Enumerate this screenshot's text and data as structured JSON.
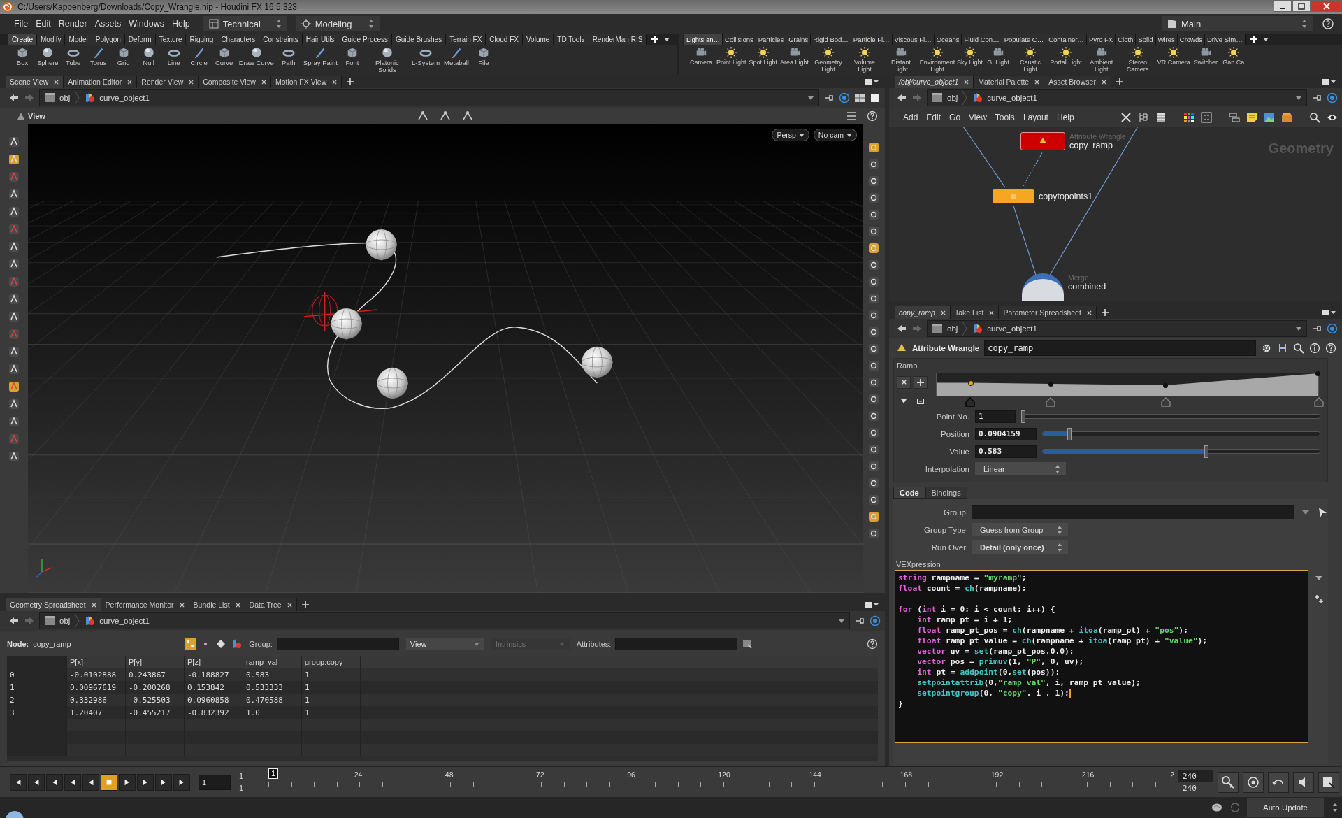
{
  "window": {
    "title": "C:/Users/Kappenberg/Downloads/Copy_Wrangle.hip - Houdini FX 16.5.323"
  },
  "menu": [
    "File",
    "Edit",
    "Render",
    "Assets",
    "Windows",
    "Help"
  ],
  "desktop": "Technical",
  "mode": "Modeling",
  "desktop_right": "Main",
  "shelf_left": {
    "tabs": [
      {
        "label": "Create",
        "selected": true
      },
      {
        "label": "Modify",
        "selected": false
      },
      {
        "label": "Model",
        "selected": false
      },
      {
        "label": "Polygon",
        "selected": false
      },
      {
        "label": "Deform",
        "selected": false
      },
      {
        "label": "Texture",
        "selected": false
      },
      {
        "label": "Rigging",
        "selected": false
      },
      {
        "label": "Characters",
        "selected": false
      },
      {
        "label": "Constraints",
        "selected": false
      },
      {
        "label": "Hair Utils",
        "selected": false
      },
      {
        "label": "Guide Process",
        "selected": false
      },
      {
        "label": "Guide Brushes",
        "selected": false
      },
      {
        "label": "Terrain FX",
        "selected": false
      },
      {
        "label": "Cloud FX",
        "selected": false
      },
      {
        "label": "Volume",
        "selected": false
      },
      {
        "label": "TD Tools",
        "selected": false
      },
      {
        "label": "RenderMan RIS",
        "selected": false
      }
    ],
    "tools": [
      "Box",
      "Sphere",
      "Tube",
      "Torus",
      "Grid",
      "Null",
      "Line",
      "Circle",
      "Curve",
      "Draw Curve",
      "Path",
      "Spray Paint",
      "Font",
      "Platonic Solids",
      "L-System",
      "Metaball",
      "File"
    ]
  },
  "shelf_right": {
    "tabs": [
      {
        "label": "Lights an…",
        "selected": true
      },
      {
        "label": "Collisions",
        "selected": false
      },
      {
        "label": "Particles",
        "selected": false
      },
      {
        "label": "Grains",
        "selected": false
      },
      {
        "label": "Rigid Bod…",
        "selected": false
      },
      {
        "label": "Particle Fl…",
        "selected": false
      },
      {
        "label": "Viscous Fl…",
        "selected": false
      },
      {
        "label": "Oceans",
        "selected": false
      },
      {
        "label": "Fluid Con…",
        "selected": false
      },
      {
        "label": "Populate C…",
        "selected": false
      },
      {
        "label": "Container…",
        "selected": false
      },
      {
        "label": "Pyro FX",
        "selected": false
      },
      {
        "label": "Cloth",
        "selected": false
      },
      {
        "label": "Solid",
        "selected": false
      },
      {
        "label": "Wires",
        "selected": false
      },
      {
        "label": "Crowds",
        "selected": false
      },
      {
        "label": "Drive Sim…",
        "selected": false
      }
    ],
    "tools": [
      "Camera",
      "Point Light",
      "Spot Light",
      "Area Light",
      "Geometry Light",
      "Volume Light",
      "Distant Light",
      "Environment Light",
      "Sky Light",
      "GI Light",
      "Caustic Light",
      "Portal Light",
      "Ambient Light",
      "Stereo Camera",
      "VR Camera",
      "Switcher",
      "Gan Ca"
    ]
  },
  "scene_view": {
    "tabs": [
      {
        "label": "Scene View",
        "selected": true
      },
      {
        "label": "Animation Editor",
        "selected": false
      },
      {
        "label": "Render View",
        "selected": false
      },
      {
        "label": "Composite View",
        "selected": false
      },
      {
        "label": "Motion FX View",
        "selected": false
      }
    ],
    "path": [
      "obj",
      "curve_object1"
    ],
    "view_label": "View",
    "camera_buttons": [
      "Persp",
      "No cam"
    ]
  },
  "spreadsheet": {
    "tabs": [
      {
        "label": "Geometry Spreadsheet",
        "selected": true
      },
      {
        "label": "Performance Monitor",
        "selected": false
      },
      {
        "label": "Bundle List",
        "selected": false
      },
      {
        "label": "Data Tree",
        "selected": false
      }
    ],
    "path": [
      "obj",
      "curve_object1"
    ],
    "node_label": "Node:",
    "node": "copy_ramp",
    "group_label": "Group:",
    "view": "View",
    "intrinsics": "Intrinsics",
    "attributes_label": "Attributes:",
    "columns": [
      "P[x]",
      "P[y]",
      "P[z]",
      "ramp_val",
      "group:copy"
    ],
    "rows": [
      {
        "index": "0",
        "cells": [
          "-0.0102888",
          "0.243867",
          "-0.188827",
          "0.583",
          "1"
        ]
      },
      {
        "index": "1",
        "cells": [
          "0.00967619",
          "-0.200268",
          "0.153842",
          "0.533333",
          "1"
        ]
      },
      {
        "index": "2",
        "cells": [
          "0.332986",
          "-0.525503",
          "0.0960858",
          "0.470588",
          "1"
        ]
      },
      {
        "index": "3",
        "cells": [
          "1.20407",
          "-0.455217",
          "-0.832392",
          "1.0",
          "1"
        ]
      }
    ]
  },
  "network": {
    "tabs": [
      {
        "label": "/obj/curve_object1",
        "selected": true
      },
      {
        "label": "Material Palette",
        "selected": false
      },
      {
        "label": "Asset Browser",
        "selected": false
      }
    ],
    "path": [
      "obj",
      "curve_object1"
    ],
    "menu": [
      "Add",
      "Edit",
      "Go",
      "View",
      "Tools",
      "Layout",
      "Help"
    ],
    "context": "Geometry",
    "nodes": [
      {
        "kind": "wrangle",
        "type": "Attribute Wrangle",
        "name": "copy_ramp"
      },
      {
        "kind": "copy",
        "name": "copytopoints1"
      },
      {
        "kind": "merge",
        "type": "Merge",
        "name": "combined"
      }
    ]
  },
  "parameters": {
    "tabs": [
      {
        "label": "copy_ramp",
        "selected": true
      },
      {
        "label": "Take List",
        "selected": false
      },
      {
        "label": "Parameter Spreadsheet",
        "selected": false
      }
    ],
    "path": [
      "obj",
      "curve_object1"
    ],
    "node_type": "Attribute Wrangle",
    "node_name": "copy_ramp",
    "ramp_label": "Ramp",
    "ramp_keys": [
      {
        "selected": true
      },
      {
        "selected": false
      },
      {
        "selected": false
      },
      {
        "selected": false
      }
    ],
    "sliders": [
      {
        "label": "Point No.",
        "value": "1",
        "level": 0
      },
      {
        "label": "Position",
        "value": "0.0904159",
        "level": 0.09
      },
      {
        "label": "Value",
        "value": "0.583",
        "level": 0.583
      }
    ],
    "interpolation": {
      "label": "Interpolation",
      "value": "Linear"
    },
    "code_tabs": [
      {
        "label": "Code",
        "selected": true
      },
      {
        "label": "Bindings",
        "selected": false
      }
    ],
    "group": {
      "label": "Group"
    },
    "group_type": {
      "label": "Group Type",
      "value": "Guess from Group"
    },
    "run_over": {
      "label": "Run Over",
      "value": "Detail (only once)"
    },
    "vex_label": "VEXpression",
    "code": [
      {
        "tokens": [
          {
            "kind": "kw",
            "text": "string"
          },
          {
            "kind": "plain",
            "text": " rampname = "
          },
          {
            "kind": "str",
            "text": "\"myramp\""
          },
          {
            "kind": "plain",
            "text": ";"
          }
        ]
      },
      {
        "tokens": [
          {
            "kind": "kw",
            "text": "float"
          },
          {
            "kind": "plain",
            "text": " count = "
          },
          {
            "kind": "fn",
            "text": "ch"
          },
          {
            "kind": "plain",
            "text": "(rampname);"
          }
        ]
      },
      {
        "blank": true
      },
      {
        "tokens": [
          {
            "kind": "kw",
            "text": "for"
          },
          {
            "kind": "plain",
            "text": " ("
          },
          {
            "kind": "kw",
            "text": "int"
          },
          {
            "kind": "plain",
            "text": " i = 0; i < count; i++) {"
          }
        ]
      },
      {
        "indent": true,
        "tokens": [
          {
            "kind": "kw",
            "text": "int"
          },
          {
            "kind": "plain",
            "text": " ramp_pt = i + 1;"
          }
        ]
      },
      {
        "indent": true,
        "tokens": [
          {
            "kind": "kw",
            "text": "float"
          },
          {
            "kind": "plain",
            "text": " ramp_pt_pos = "
          },
          {
            "kind": "fn",
            "text": "ch"
          },
          {
            "kind": "plain",
            "text": "(rampname + "
          },
          {
            "kind": "fn",
            "text": "itoa"
          },
          {
            "kind": "plain",
            "text": "(ramp_pt) + "
          },
          {
            "kind": "str",
            "text": "\"pos\""
          },
          {
            "kind": "plain",
            "text": ");"
          }
        ]
      },
      {
        "indent": true,
        "tokens": [
          {
            "kind": "kw",
            "text": "float"
          },
          {
            "kind": "plain",
            "text": " ramp_pt_value = "
          },
          {
            "kind": "fn",
            "text": "ch"
          },
          {
            "kind": "plain",
            "text": "(rampname + "
          },
          {
            "kind": "fn",
            "text": "itoa"
          },
          {
            "kind": "plain",
            "text": "(ramp_pt) + "
          },
          {
            "kind": "str",
            "text": "\"value\""
          },
          {
            "kind": "plain",
            "text": ");"
          }
        ]
      },
      {
        "indent": true,
        "tokens": [
          {
            "kind": "kw",
            "text": "vector"
          },
          {
            "kind": "plain",
            "text": " uv = "
          },
          {
            "kind": "fn",
            "text": "set"
          },
          {
            "kind": "plain",
            "text": "(ramp_pt_pos,0,0);"
          }
        ]
      },
      {
        "indent": true,
        "tokens": [
          {
            "kind": "kw",
            "text": "vector"
          },
          {
            "kind": "plain",
            "text": " pos = "
          },
          {
            "kind": "fn",
            "text": "primuv"
          },
          {
            "kind": "plain",
            "text": "(1, "
          },
          {
            "kind": "str",
            "text": "\"P\""
          },
          {
            "kind": "plain",
            "text": ", 0, uv);"
          }
        ]
      },
      {
        "indent": true,
        "tokens": [
          {
            "kind": "kw",
            "text": "int"
          },
          {
            "kind": "plain",
            "text": " pt = "
          },
          {
            "kind": "fn",
            "text": "addpoint"
          },
          {
            "kind": "plain",
            "text": "(0,"
          },
          {
            "kind": "fn",
            "text": "set"
          },
          {
            "kind": "plain",
            "text": "(pos));"
          }
        ]
      },
      {
        "indent": true,
        "tokens": [
          {
            "kind": "fn",
            "text": "setpointattrib"
          },
          {
            "kind": "plain",
            "text": "(0,"
          },
          {
            "kind": "str",
            "text": "\"ramp_val\""
          },
          {
            "kind": "plain",
            "text": ", i, ramp_pt_value);"
          }
        ]
      },
      {
        "indent": true,
        "tokens": [
          {
            "kind": "fn",
            "text": "setpointgroup"
          },
          {
            "kind": "plain",
            "text": "(0, "
          },
          {
            "kind": "str",
            "text": "\"copy\""
          },
          {
            "kind": "plain",
            "text": ", i , 1);"
          }
        ],
        "cursor": true
      },
      {
        "tokens": [
          {
            "kind": "plain",
            "text": "}"
          }
        ]
      }
    ]
  },
  "timeline": {
    "frame": "1",
    "start": [
      "1",
      "1"
    ],
    "marker": "1",
    "ticks": [
      "24",
      "48",
      "72",
      "96",
      "120",
      "144",
      "168",
      "192",
      "216"
    ],
    "cut_tick": "2",
    "end": [
      "240",
      "240"
    ]
  },
  "status": {
    "button": "Auto Update"
  }
}
